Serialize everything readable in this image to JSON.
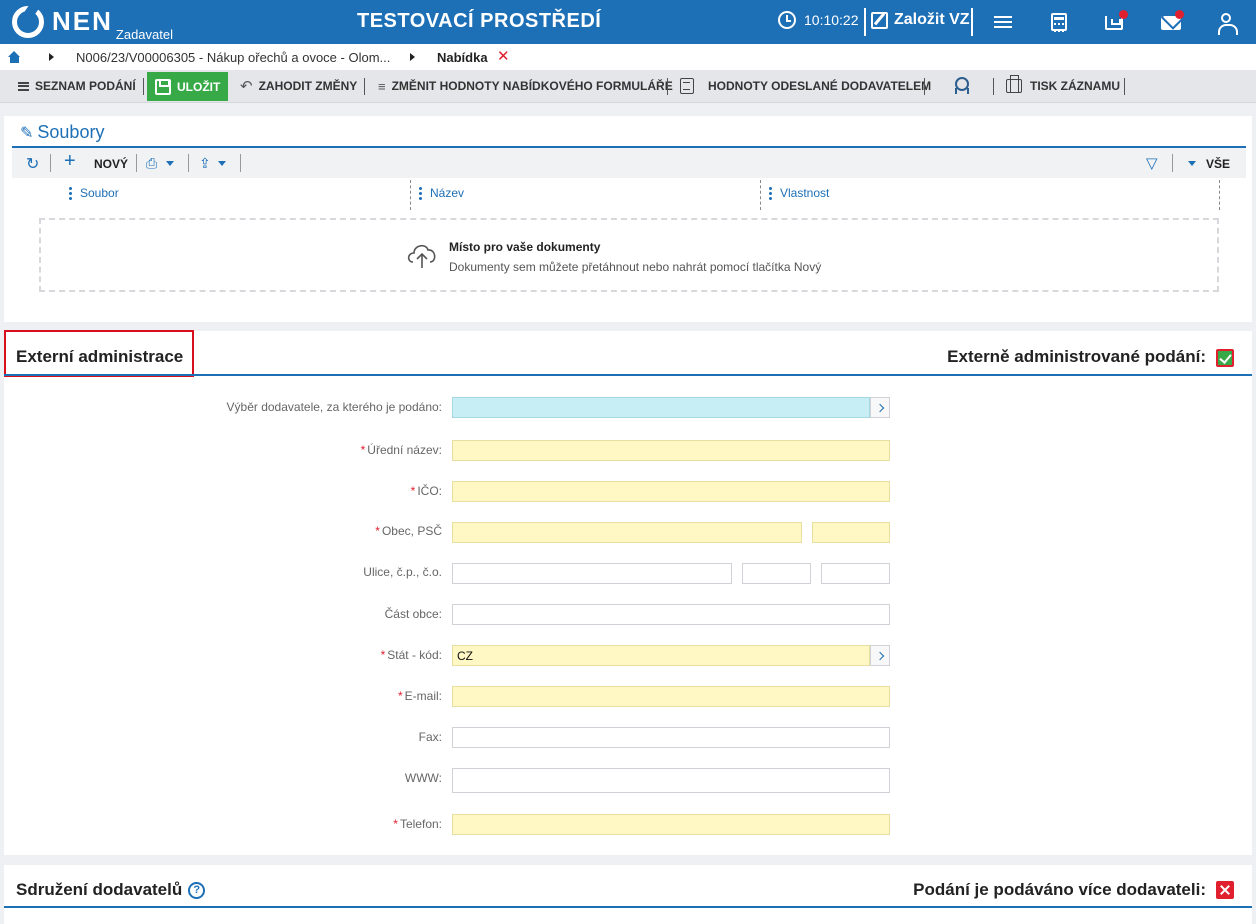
{
  "header": {
    "logo_text": "NEN",
    "logo_sub": "Zadavatel",
    "environment_title": "TESTOVACÍ PROSTŘEDÍ",
    "clock": "10:10:22",
    "create_label": "Založit VZ",
    "brand_color": "#1d6fb6",
    "notification_color": "#e0202e"
  },
  "breadcrumb": {
    "item1": "N006/23/V00006305 - Nákup ořechů a ovoce - Olom...",
    "item2": "Nabídka"
  },
  "toolbar": {
    "list": "SEZNAM PODÁNÍ",
    "save": "ULOŽIT",
    "discard": "ZAHODIT ZMĚNY",
    "change_values": "ZMĚNIT HODNOTY NABÍDKOVÉHO FORMULÁŘE",
    "supplier_values": "HODNOTY ODESLANÉ DODAVATELEM",
    "print": "TISK ZÁZNAMU"
  },
  "files": {
    "title": "Soubory",
    "new": "NOVÝ",
    "all": "VŠE",
    "columns": [
      "Soubor",
      "Název",
      "Vlastnost"
    ],
    "drop_title": "Místo pro vaše dokumenty",
    "drop_text": "Dokumenty sem můžete přetáhnout nebo nahrát pomocí tlačítka Nový"
  },
  "external_admin": {
    "title": "Externí administrace",
    "checkbox_label": "Externě administrované podání:",
    "checked": true,
    "fields": {
      "supplier_select": {
        "label": "Výběr dodavatele, za kterého je podáno:",
        "value": ""
      },
      "official_name": {
        "label": "Úřední název:",
        "value": ""
      },
      "ico": {
        "label": "IČO:",
        "value": ""
      },
      "city_zip": {
        "label": "Obec, PSČ",
        "value": ""
      },
      "street": {
        "label": "Ulice, č.p., č.o.",
        "value": ""
      },
      "district": {
        "label": "Část obce:",
        "value": ""
      },
      "country": {
        "label": "Stát - kód:",
        "value": "CZ"
      },
      "email": {
        "label": "E-mail:",
        "value": ""
      },
      "fax": {
        "label": "Fax:",
        "value": ""
      },
      "www": {
        "label": "WWW:",
        "value": ""
      },
      "phone": {
        "label": "Telefon:",
        "value": ""
      }
    },
    "required_mark": "*"
  },
  "consortium": {
    "title": "Sdružení dodavatelů",
    "help": "?",
    "checkbox_label": "Podání je podáváno více dodavateli:",
    "checked": false
  }
}
